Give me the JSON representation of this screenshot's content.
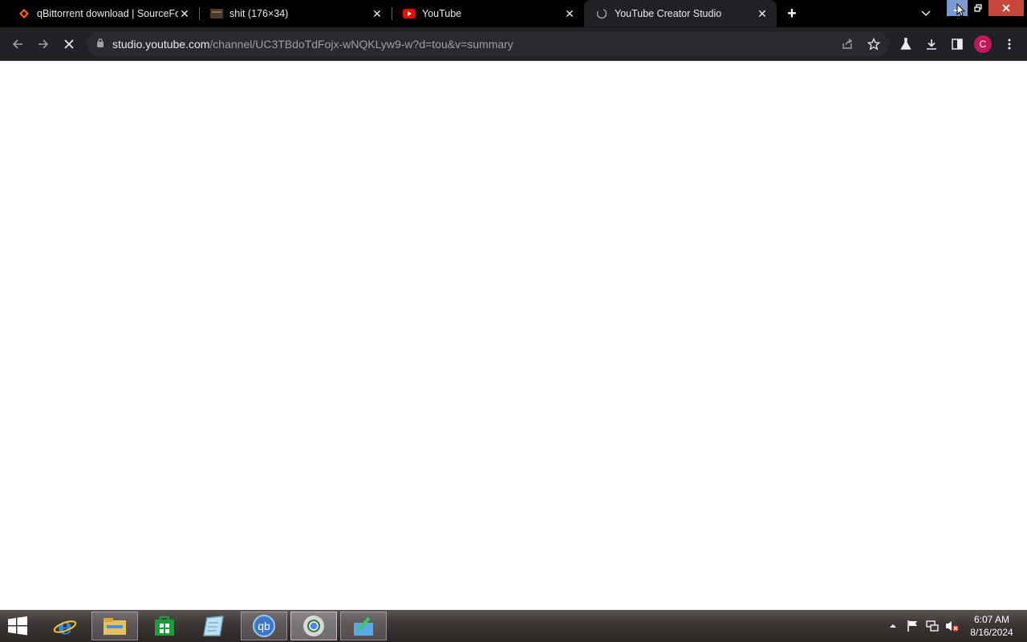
{
  "browser": {
    "tabs": [
      {
        "title": "qBittorrent download | SourceFo",
        "icon": "sourceforge-icon",
        "active": false
      },
      {
        "title": "shit (176×34)",
        "icon": "image-thumbnail-icon",
        "active": false
      },
      {
        "title": "YouTube",
        "icon": "youtube-icon",
        "active": false
      },
      {
        "title": "YouTube Creator Studio",
        "icon": "loading-globe-icon",
        "active": true
      }
    ],
    "address": {
      "domain": "studio.youtube.com",
      "path": "/channel/UC3TBdoTdFojx-wNQKLyw9-w?d=tou&v=summary"
    },
    "profile_initial": "C"
  },
  "taskbar": {
    "apps": [
      {
        "name": "internet-explorer-icon"
      },
      {
        "name": "file-explorer-icon"
      },
      {
        "name": "windows-store-icon"
      },
      {
        "name": "notepad-icon"
      },
      {
        "name": "qbittorrent-icon"
      },
      {
        "name": "chrome-icon"
      },
      {
        "name": "paint-icon"
      }
    ],
    "clock": {
      "time": "6:07 AM",
      "date": "8/16/2024"
    }
  },
  "colors": {
    "tab_strip": "#000000",
    "toolbar": "#202124",
    "accent_avatar": "#c2185b",
    "youtube_red": "#ff0000"
  }
}
